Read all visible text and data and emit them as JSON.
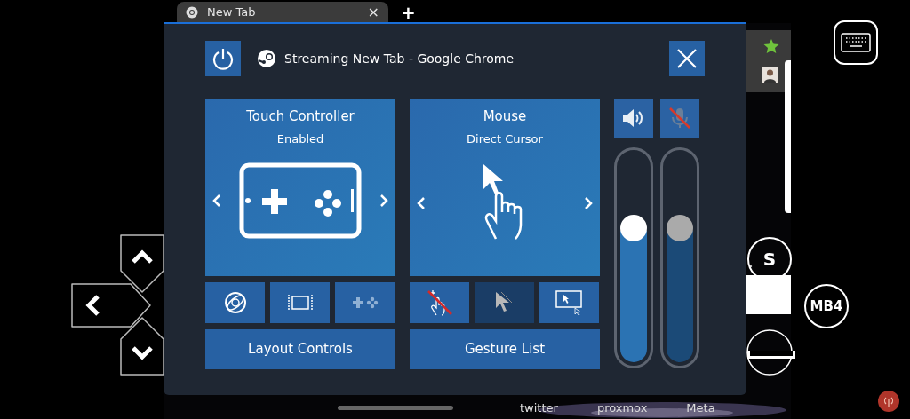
{
  "browser_tab": {
    "title": "New Tab",
    "close": "×",
    "new_tab": "+"
  },
  "panel": {
    "title": "Streaming New Tab - Google Chrome"
  },
  "modes": [
    {
      "title": "Touch Controller",
      "subtitle": "Enabled",
      "kind": "gamepad"
    },
    {
      "title": "Mouse",
      "subtitle": "Direct Cursor",
      "kind": "pointer"
    }
  ],
  "controller_tools": [
    {
      "kind": "gyro",
      "disabled": false
    },
    {
      "kind": "frame",
      "disabled": false
    },
    {
      "kind": "gamepad",
      "disabled": true
    }
  ],
  "mouse_tools": [
    {
      "kind": "touch-off",
      "selected": false
    },
    {
      "kind": "cursor",
      "selected": true
    },
    {
      "kind": "trackpad",
      "selected": false
    }
  ],
  "layout_button": "Layout Controls",
  "gesture_button": "Gesture List",
  "audio": [
    {
      "kind": "speaker",
      "muted": false,
      "level": 0.63
    },
    {
      "kind": "mic",
      "muted": true,
      "level": 0.63
    }
  ],
  "overlay_buttons": [
    "S",
    "MB4"
  ],
  "bookmarks": [
    "twitter",
    "proxmox",
    "Meta"
  ]
}
